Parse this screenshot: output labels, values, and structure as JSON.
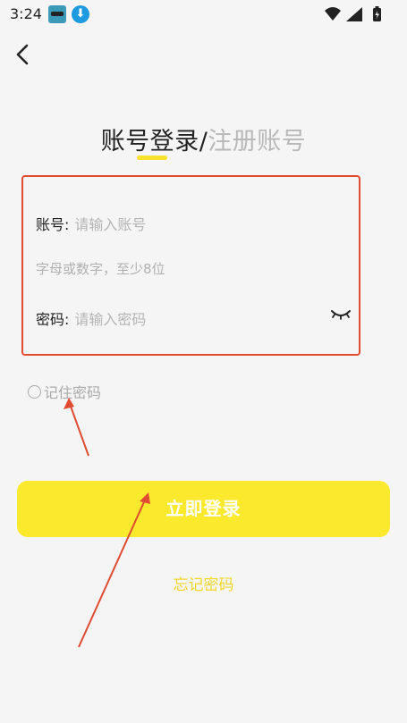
{
  "status_bar": {
    "time": "3:24",
    "icons": [
      "app-notification-icon",
      "download-icon",
      "wifi-icon",
      "signal-icon",
      "battery-icon"
    ]
  },
  "nav": {
    "back_icon": "chevron-left-icon"
  },
  "title": {
    "login_tab": "账号登录",
    "separator": "/",
    "register_tab": "注册账号",
    "underline_color": "#f9e22e"
  },
  "form": {
    "account": {
      "label": "账号:",
      "placeholder": "请输入账号",
      "value": ""
    },
    "hint": "字母或数字，至少8位",
    "password": {
      "label": "密码:",
      "placeholder": "请输入密码",
      "value": ""
    },
    "password_toggle_icon": "eye-closed-icon",
    "annotation_color": "#e04b32"
  },
  "remember": {
    "label": "记住密码",
    "checked": false
  },
  "login_button": {
    "label": "立即登录",
    "color": "#fbe92e"
  },
  "forgot_link": {
    "label": "忘记密码",
    "color": "#f2d729"
  }
}
